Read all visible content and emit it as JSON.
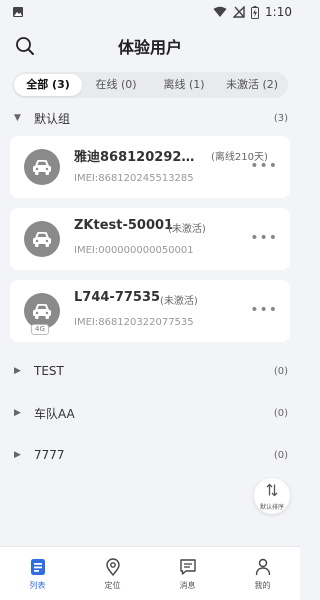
{
  "status_bar": {
    "time": "1:10"
  },
  "header": {
    "title": "体验用户"
  },
  "tabs": [
    {
      "label": "全部 (3)",
      "active": true
    },
    {
      "label": "在线 (0)",
      "active": false
    },
    {
      "label": "离线 (1)",
      "active": false
    },
    {
      "label": "未激活 (2)",
      "active": false
    }
  ],
  "default_group": {
    "name": "默认组",
    "count": "(3)",
    "devices": [
      {
        "name": "雅迪86812029259...",
        "state": "(离线210天)",
        "imei": "IMEI:868120245513285",
        "badge": ""
      },
      {
        "name": "ZKtest-50001",
        "state": "(未激活)",
        "imei": "IMEI:000000000050001",
        "badge": ""
      },
      {
        "name": "L744-77535",
        "state": "(未激活)",
        "imei": "IMEI:868120322077535",
        "badge": "4G"
      }
    ]
  },
  "other_groups": [
    {
      "name": "TEST",
      "count": "(0)"
    },
    {
      "name": "车队AA",
      "count": "(0)"
    },
    {
      "name": "7777",
      "count": "(0)"
    }
  ],
  "sort_button": {
    "label": "默认排序"
  },
  "bottom_nav": [
    {
      "label": "列表",
      "icon": "list-icon",
      "active": true
    },
    {
      "label": "定位",
      "icon": "location-pin-icon",
      "active": false
    },
    {
      "label": "消息",
      "icon": "message-icon",
      "active": false
    },
    {
      "label": "我的",
      "icon": "person-icon",
      "active": false
    }
  ],
  "colors": {
    "accent": "#2f6de0",
    "background": "#f3f4f8",
    "avatar": "#8a8a8a"
  }
}
